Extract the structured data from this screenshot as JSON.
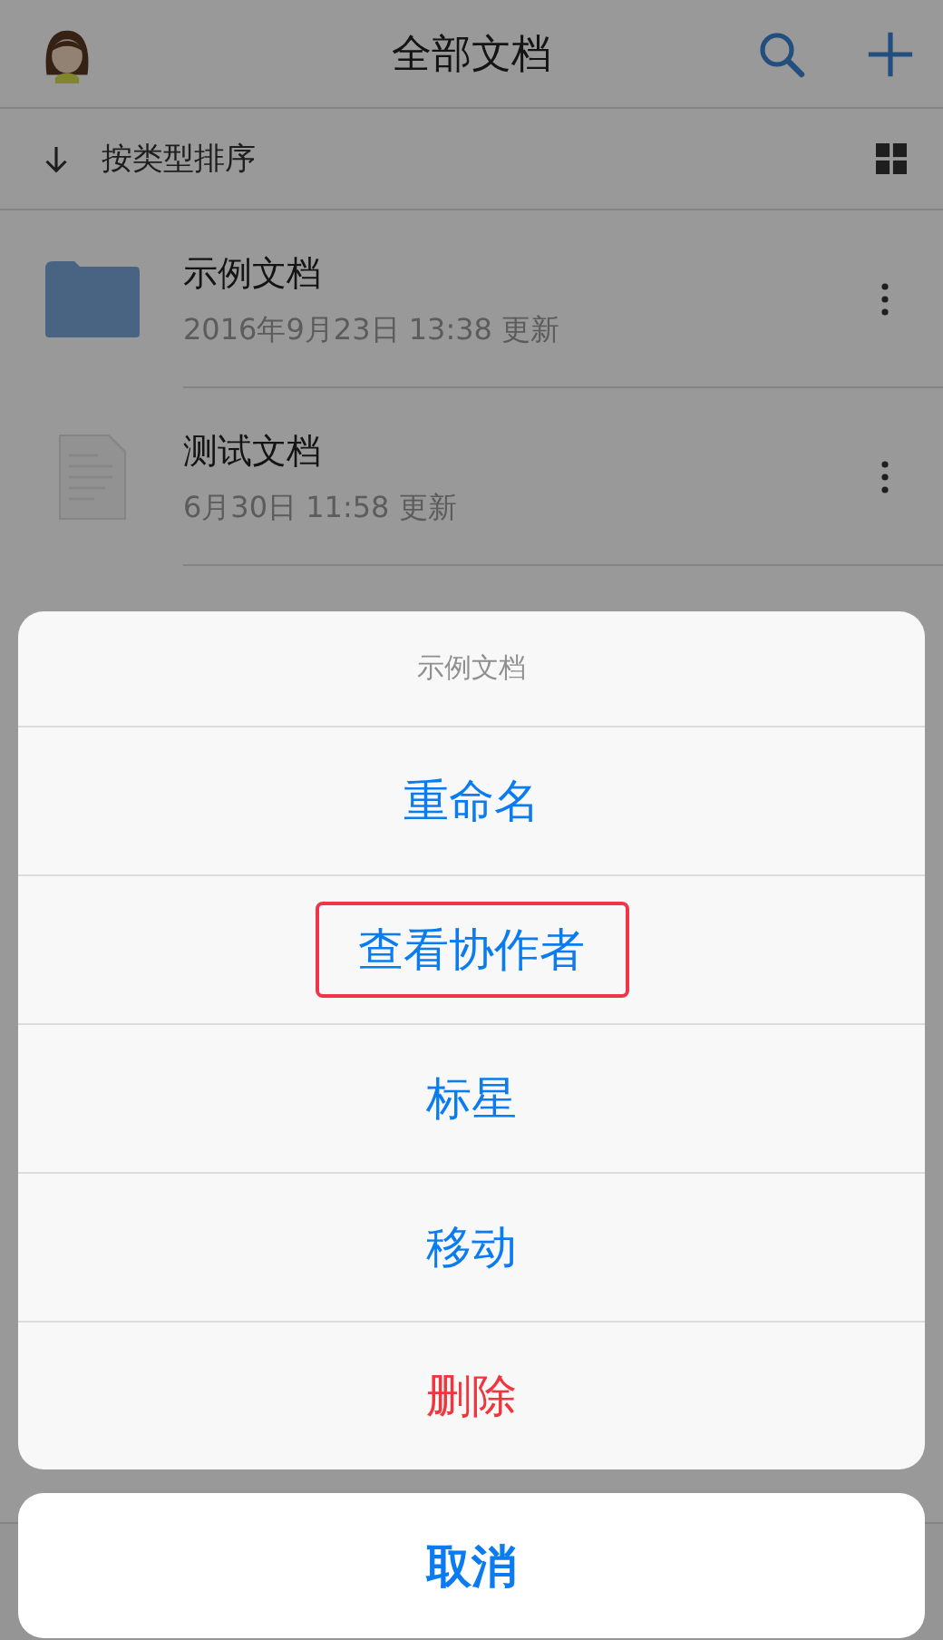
{
  "header": {
    "title": "全部文档"
  },
  "sort_bar": {
    "label": "按类型排序"
  },
  "documents": [
    {
      "kind": "folder",
      "name": "示例文档",
      "updated": "2016年9月23日 13:38 更新"
    },
    {
      "kind": "file",
      "name": "测试文档",
      "updated": "6月30日 11:58 更新"
    }
  ],
  "action_sheet": {
    "title": "示例文档",
    "actions": [
      {
        "label": "重命名",
        "kind": "normal",
        "highlighted": false
      },
      {
        "label": "查看协作者",
        "kind": "normal",
        "highlighted": true
      },
      {
        "label": "标星",
        "kind": "normal",
        "highlighted": false
      },
      {
        "label": "移动",
        "kind": "normal",
        "highlighted": false
      },
      {
        "label": "删除",
        "kind": "destructive",
        "highlighted": false
      }
    ],
    "cancel": "取消"
  }
}
